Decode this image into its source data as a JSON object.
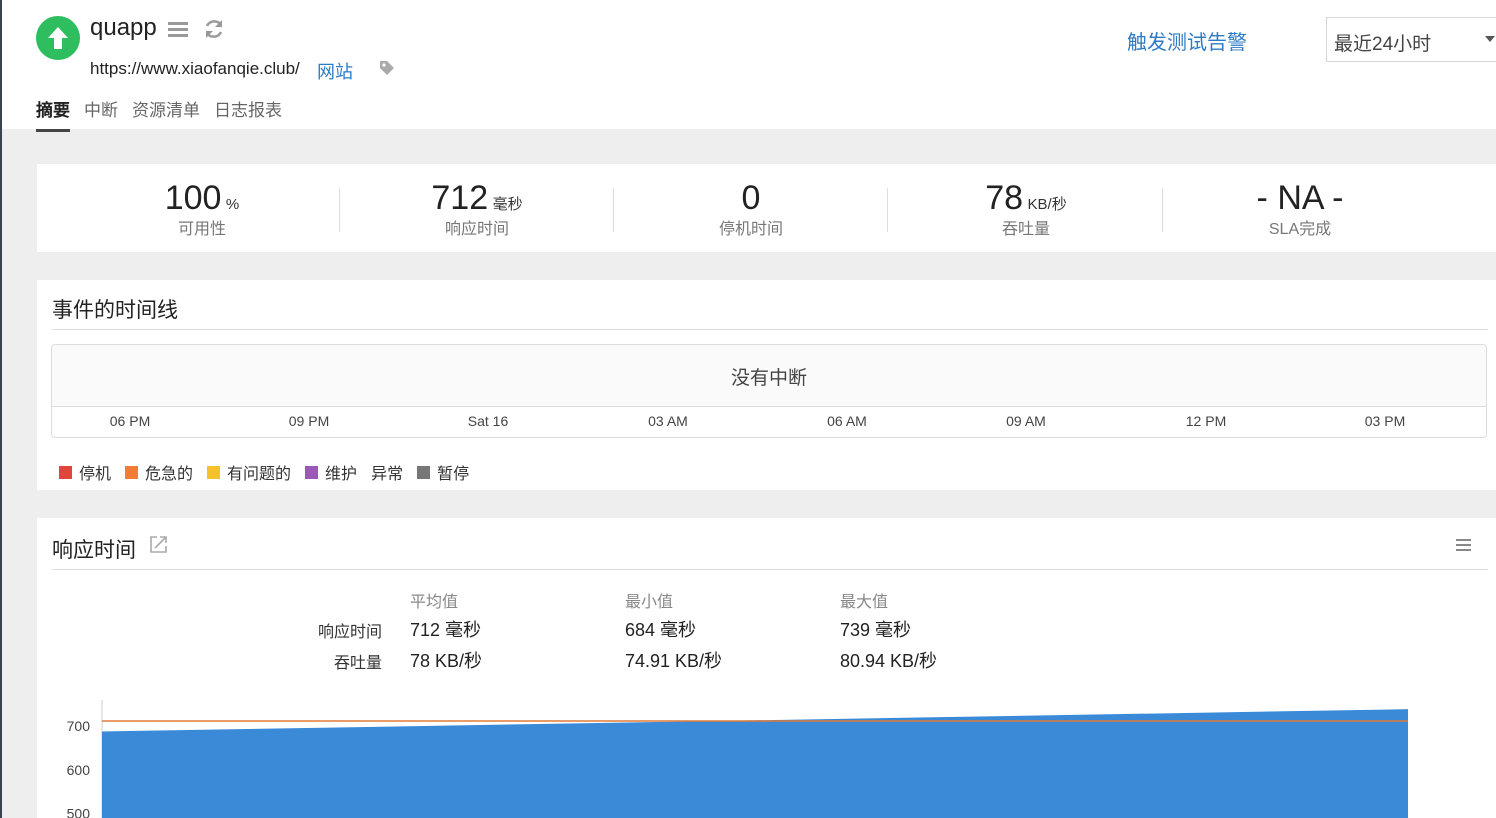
{
  "monitor": {
    "name": "quapp",
    "url": "https://www.xiaofanqie.club/",
    "type": "网站",
    "trigger_alert": "触发测试告警",
    "period": "最近24小时"
  },
  "tabs": [
    {
      "label": "摘要"
    },
    {
      "label": "中断"
    },
    {
      "label": "资源清单"
    },
    {
      "label": "日志报表"
    }
  ],
  "summary": [
    {
      "value": "100",
      "unit": "%",
      "label": "可用性"
    },
    {
      "value": "712",
      "unit": "毫秒",
      "label": "响应时间"
    },
    {
      "value": "0",
      "unit": "",
      "label": "停机时间"
    },
    {
      "value": "78",
      "unit": "KB/秒",
      "label": "吞吐量"
    },
    {
      "value": "- NA -",
      "unit": "",
      "label": "SLA完成"
    }
  ],
  "timeline": {
    "title": "事件的时间线",
    "message": "没有中断",
    "ticks": [
      "06 PM",
      "09 PM",
      "Sat 16",
      "03 AM",
      "06 AM",
      "09 AM",
      "12 PM",
      "03 PM"
    ],
    "legend": [
      {
        "label": "停机",
        "color": "#e0463a"
      },
      {
        "label": "危急的",
        "color": "#f07d33"
      },
      {
        "label": "有问题的",
        "color": "#f5c22b"
      },
      {
        "label": "维护",
        "color": "#9b59b6"
      },
      {
        "label": "异常",
        "color": ""
      },
      {
        "label": "暂停",
        "color": "#777777"
      }
    ]
  },
  "response": {
    "title": "响应时间",
    "columns": [
      "平均值",
      "最小值",
      "最大值"
    ],
    "rows": [
      {
        "label": "响应时间",
        "avg": "712 毫秒",
        "min": "684 毫秒",
        "max": "739 毫秒"
      },
      {
        "label": "吞吐量",
        "avg": "78 KB/秒",
        "min": "74.91 KB/秒",
        "max": "80.94 KB/秒"
      }
    ]
  },
  "chart_data": {
    "type": "area",
    "series": [
      {
        "values": [
          688,
          739
        ]
      }
    ],
    "reference_line": 712,
    "y_ticks": [
      700,
      600,
      500
    ],
    "ylim": [
      490,
      760
    ],
    "area_color": "#3a8ad8",
    "reference_color": "#e07b39"
  }
}
